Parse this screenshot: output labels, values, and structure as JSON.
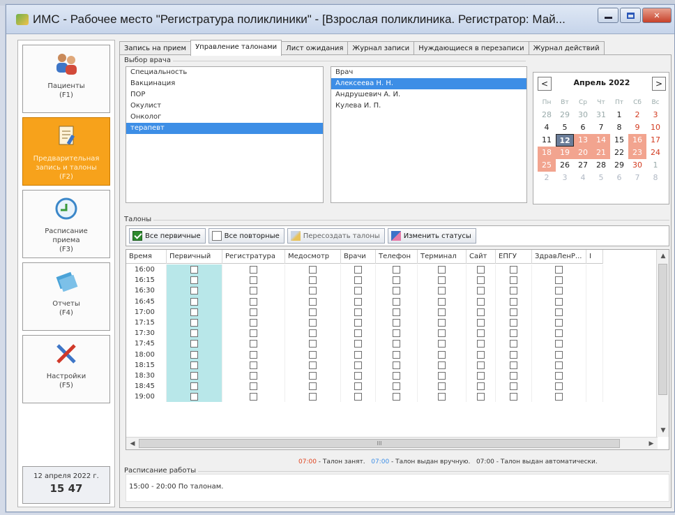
{
  "window": {
    "title": "ИМС - Рабочее место \"Регистратура поликлиники\" - [Взрослая поликлиника. Регистратор: Май..."
  },
  "nav": {
    "items": [
      {
        "label": "Пациенты\n(F1)",
        "icon": "patients-icon"
      },
      {
        "label": "Предварительная\nзапись и талоны\n(F2)",
        "icon": "appointment-icon",
        "active": true
      },
      {
        "label": "Расписание\nприема\n(F3)",
        "icon": "schedule-icon"
      },
      {
        "label": "Отчеты\n(F4)",
        "icon": "reports-icon"
      },
      {
        "label": "Настройки\n(F5)",
        "icon": "settings-icon"
      }
    ],
    "clock": {
      "date": "12 апреля 2022 г.",
      "time": "15 47"
    }
  },
  "tabs": [
    "Запись на прием",
    "Управление талонами",
    "Лист ожидания",
    "Журнал записи",
    "Нуждающиеся в перезаписи",
    "Журнал действий"
  ],
  "active_tab": 1,
  "doctor_select": {
    "group_label": "Выбор врача",
    "specialty": {
      "header": "Специальность",
      "items": [
        "Вакцинация",
        "ПОР",
        "Окулист",
        "Онколог",
        "терапевт"
      ],
      "selected": 4
    },
    "doctor": {
      "header": "Врач",
      "items": [
        "Алексеева Н. Н.",
        "Андрушевич А. И.",
        "Кулева И. П."
      ],
      "selected": 0
    }
  },
  "calendar": {
    "title": "Апрель 2022",
    "prev": "<",
    "next": ">",
    "weekdays": [
      "Пн",
      "Вт",
      "Ср",
      "Чт",
      "Пт",
      "Сб",
      "Вс"
    ],
    "weeks": [
      [
        "28",
        "29",
        "30",
        "31",
        "1",
        "2",
        "3"
      ],
      [
        "4",
        "5",
        "6",
        "7",
        "8",
        "9",
        "10"
      ],
      [
        "11",
        "12",
        "13",
        "14",
        "15",
        "16",
        "17"
      ],
      [
        "18",
        "19",
        "20",
        "21",
        "22",
        "23",
        "24"
      ],
      [
        "25",
        "26",
        "27",
        "28",
        "29",
        "30",
        "1"
      ],
      [
        "2",
        "3",
        "4",
        "5",
        "6",
        "7",
        "8"
      ]
    ],
    "colors": {
      "busy": "#f2a48f",
      "today": "#6a7d99",
      "weekend": "#d23a1f"
    }
  },
  "tickets": {
    "group_label": "Талоны",
    "toolbar": {
      "all_primary": "Все первичные",
      "all_repeat": "Все повторные",
      "recreate": "Пересоздать талоны",
      "change_status": "Изменить статусы"
    },
    "columns": [
      "Время",
      "Первичный",
      "Регистратура",
      "Медосмотр",
      "Врачи",
      "Телефон",
      "Терминал",
      "Сайт",
      "ЕПГУ",
      "ЗдравЛенР...",
      "I"
    ],
    "times": [
      "16:00",
      "16:15",
      "16:30",
      "16:45",
      "17:00",
      "17:15",
      "17:30",
      "17:45",
      "18:00",
      "18:15",
      "18:30",
      "18:45",
      "19:00"
    ],
    "hscroll_mid": "III"
  },
  "legend": {
    "busy_time": "07:00",
    "busy_text": " - Талон занят.",
    "manual_time": "07:00",
    "manual_text": " - Талон выдан вручную.",
    "auto_text": "07:00 - Талон выдан автоматически."
  },
  "work_schedule": {
    "group_label": "Расписание работы",
    "text": "15:00 - 20:00 По талонам."
  }
}
